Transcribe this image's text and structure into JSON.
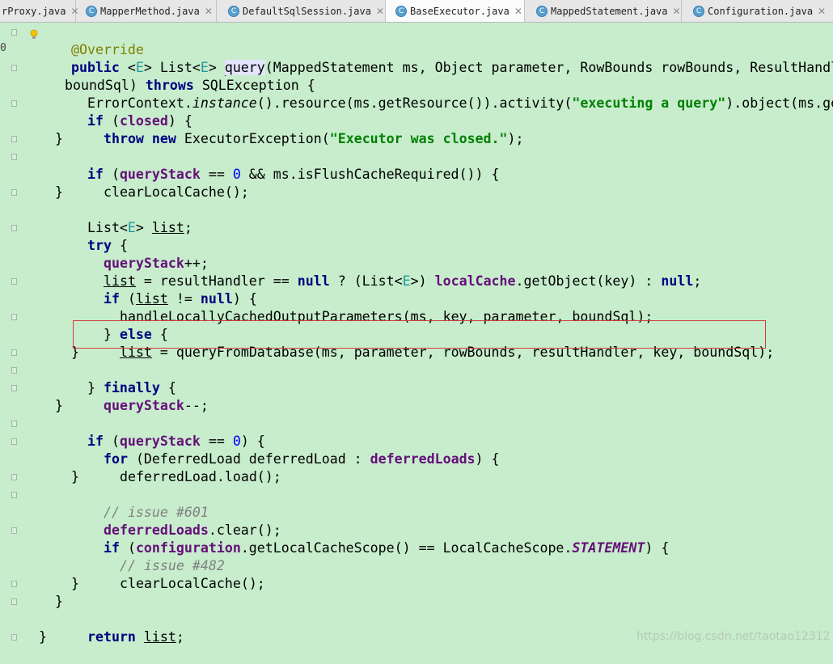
{
  "tabs": [
    {
      "label": "rProxy.java"
    },
    {
      "label": "MapperMethod.java"
    },
    {
      "label": "DefaultSqlSession.java"
    },
    {
      "label": "BaseExecutor.java"
    },
    {
      "label": "MappedStatement.java"
    },
    {
      "label": "Configuration.java"
    }
  ],
  "tab_icon_glyph": "C",
  "tab_close_glyph": "✕",
  "gutter_digit": "0",
  "code": {
    "override": "@Override",
    "sig_public": "public",
    "sig_E1": "E",
    "sig_list": "List<",
    "sig_E2": "E",
    "sig_query": "query",
    "sig_params": "(MappedStatement ms, Object parameter, RowBounds rowBounds, ResultHandler r",
    "sig2_bound": "boundSql) ",
    "sig2_throws": "throws",
    "sig2_exc": " SQLException {",
    "l3_a": "ErrorContext.",
    "l3_instance": "instance",
    "l3_b": "().resource(ms.getResource()).activity(",
    "l3_str": "\"executing a query\"",
    "l3_c": ").object(ms.getId",
    "if": "if",
    "closed": "closed",
    "throw": "throw",
    "new": "new",
    "exec_exc": " ExecutorException(",
    "exec_str": "\"Executor was closed.\"",
    "queryStack": "queryStack",
    "zero": "0",
    "flush": " && ms.isFlushCacheRequired()) {",
    "clearLocalCache": "clearLocalCache();",
    "list_decl_a": "List<",
    "list_decl_E": "E",
    "list_var": "list",
    "try": "try",
    "inc": "++;",
    "rh_a": " = resultHandler == ",
    "null": "null",
    "rh_b": " ? (List<",
    "rh_E": "E",
    "rh_c": ">) ",
    "localCache": "localCache",
    "rh_d": ".getObject(key) : ",
    "if_list_ne": " != ",
    "handle": "handleLocallyCachedOutputParameters(ms, key, parameter, boundSql);",
    "else": "else",
    "qfd": " = queryFromDatabase(ms, parameter, rowBounds, resultHandler, key, boundSql);",
    "finally": "finally",
    "dec": "--;",
    "for": "for",
    "dl_a": " (DeferredLoad deferredLoad : ",
    "deferredLoads": "deferredLoads",
    "dl_load": "deferredLoad.load();",
    "c601": "// issue #601",
    "dl_clear": ".clear();",
    "configuration": "configuration",
    "scope_a": ".getLocalCacheScope() == LocalCacheScope.",
    "statement": "STATEMENT",
    "c482": "// issue #482",
    "return": "return"
  },
  "watermark": "https://blog.csdn.net/taotao12312"
}
